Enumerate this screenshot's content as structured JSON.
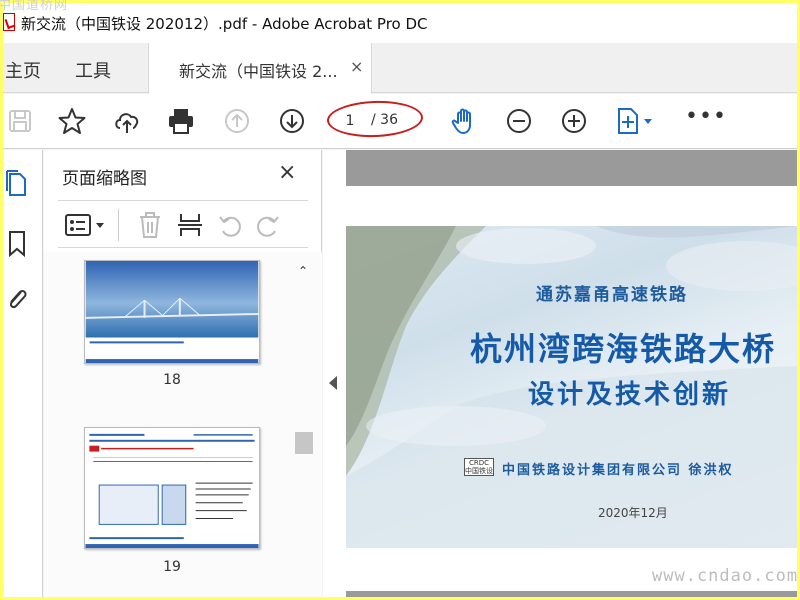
{
  "watermarks": {
    "top": "中国道桥网",
    "bottom": "www.cndao.com"
  },
  "window": {
    "title": "新交流（中国铁设 202012）.pdf - Adobe Acrobat Pro DC"
  },
  "nav": {
    "home": "主页",
    "tools": "工具",
    "doc_tab": "新交流（中国铁设 2...",
    "doc_tab_close": "×"
  },
  "toolbar": {
    "icons": [
      "save-icon",
      "star-icon",
      "cloud-upload-icon",
      "print-icon",
      "page-up-icon",
      "page-down-icon",
      "hand-icon",
      "zoom-out-icon",
      "zoom-in-icon",
      "fit-page-icon"
    ],
    "page_current": "1",
    "page_total": "/ 36",
    "more": "•••",
    "accent": "#1b6ac9"
  },
  "thumbnails": {
    "title": "页面缩略图",
    "close": "×",
    "pages": [
      {
        "number": "18"
      },
      {
        "number": "19"
      }
    ]
  },
  "slide": {
    "subtitle": "通苏嘉甬高速铁路",
    "title": "杭州湾跨海铁路大桥",
    "title2": "设计及技术创新",
    "logo": "CRDC 中国铁设",
    "org": "中国铁路设计集团有限公司  徐洪权",
    "date": "2020年12月"
  }
}
